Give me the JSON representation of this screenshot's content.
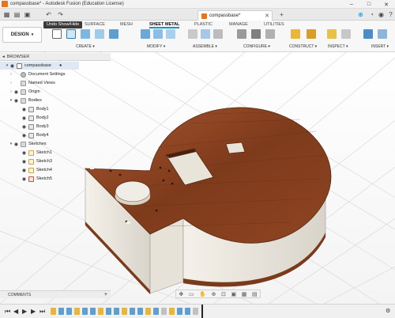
{
  "titlebar": {
    "title": "compassbase* - Autodesk Fusion (Education License)"
  },
  "document_tab": {
    "name": "compassbase*"
  },
  "tooltip": {
    "text": "Undo Show/Hide"
  },
  "workspace": {
    "label": "DESIGN"
  },
  "ribbon_tabs": [
    "SURFACE",
    "MESH",
    "SHEET METAL",
    "PLASTIC",
    "MANAGE",
    "UTILITIES"
  ],
  "ribbon_active_tab": "SHEET METAL",
  "ribbon_groups": [
    "CREATE",
    "MODIFY",
    "ASSEMBLE",
    "CONFIGURE",
    "CONSTRUCT",
    "INSPECT",
    "INSERT"
  ],
  "browser": {
    "header": "BROWSER",
    "root": "compassbase",
    "items": {
      "document_settings": "Document Settings",
      "named_views": "Named Views",
      "origin": "Origin",
      "bodies": "Bodies",
      "body1": "Body1",
      "body2": "Body2",
      "body3": "Body3",
      "body4": "Body4",
      "sketches": "Sketches",
      "sketch1": "Sketch1",
      "sketch3": "Sketch3",
      "sketch4": "Sketch4",
      "sketch5": "Sketch5"
    }
  },
  "comments": {
    "label": "COMMENTS"
  },
  "colors": {
    "wood": "#7a3a1c",
    "wood_light": "#9b4e2a",
    "side": "#ece8e0",
    "accent": "#0696d7"
  }
}
